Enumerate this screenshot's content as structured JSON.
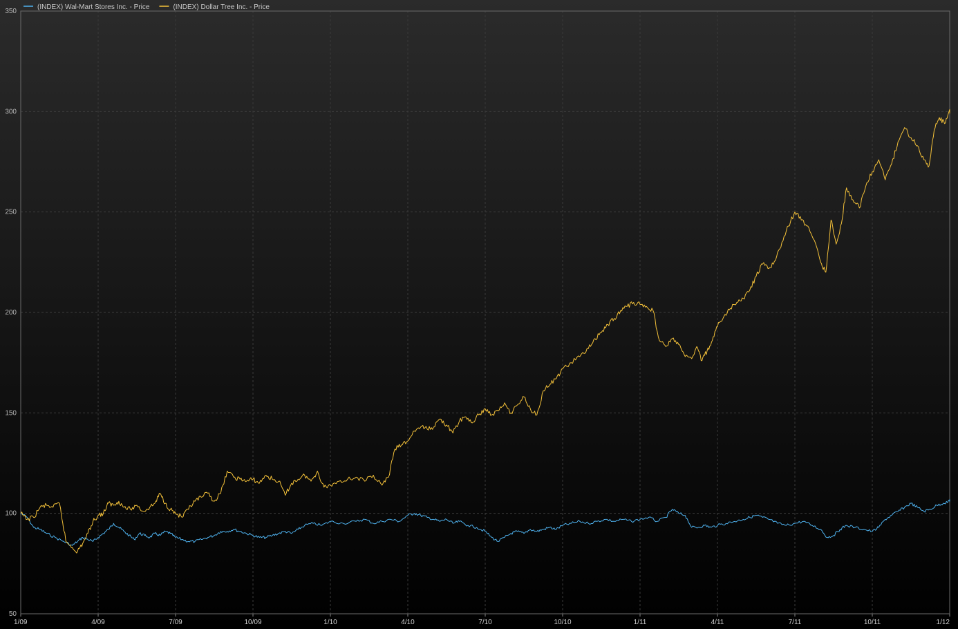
{
  "chart_data": {
    "type": "line",
    "title": "",
    "xlabel": "",
    "ylabel": "",
    "ylim": [
      50,
      350
    ],
    "y_ticks": [
      50,
      100,
      150,
      200,
      250,
      300,
      350
    ],
    "x_ticks": [
      "1/09",
      "4/09",
      "7/09",
      "10/09",
      "1/10",
      "4/10",
      "7/10",
      "10/10",
      "1/11",
      "4/11",
      "7/11",
      "10/11",
      "1/12"
    ],
    "grid": true,
    "legend_position": "top-left",
    "background_gradient": [
      "#2b2b2b",
      "#000000"
    ],
    "series": [
      {
        "name": "(INDEX) Wal-Mart Stores Inc. - Price",
        "color": "#4fb3f0",
        "points": [
          [
            "1/09",
            100
          ],
          [
            "1/09",
            98
          ],
          [
            "1/09",
            93
          ],
          [
            "1/09",
            92
          ],
          [
            "2/09",
            90
          ],
          [
            "2/09",
            88
          ],
          [
            "2/09",
            86
          ],
          [
            "3/09",
            84
          ],
          [
            "3/09",
            86
          ],
          [
            "3/09",
            88
          ],
          [
            "3/09",
            87
          ],
          [
            "3/09",
            86
          ],
          [
            "4/09",
            88
          ],
          [
            "4/09",
            90
          ],
          [
            "4/09",
            92
          ],
          [
            "4/09",
            95
          ],
          [
            "4/09",
            93
          ],
          [
            "5/09",
            91
          ],
          [
            "5/09",
            89
          ],
          [
            "5/09",
            87
          ],
          [
            "5/09",
            90
          ],
          [
            "5/09",
            89
          ],
          [
            "6/09",
            88
          ],
          [
            "6/09",
            90
          ],
          [
            "6/09",
            89
          ],
          [
            "6/09",
            91
          ],
          [
            "6/09",
            90
          ],
          [
            "7/09",
            88
          ],
          [
            "7/09",
            87
          ],
          [
            "7/09",
            86
          ],
          [
            "7/09",
            86
          ],
          [
            "8/09",
            87
          ],
          [
            "8/09",
            88
          ],
          [
            "8/09",
            89
          ],
          [
            "8/09",
            91
          ],
          [
            "9/09",
            91
          ],
          [
            "9/09",
            92
          ],
          [
            "9/09",
            91
          ],
          [
            "9/09",
            90
          ],
          [
            "10/09",
            89
          ],
          [
            "10/09",
            88
          ],
          [
            "10/09",
            88
          ],
          [
            "10/09",
            89
          ],
          [
            "11/09",
            90
          ],
          [
            "11/09",
            91
          ],
          [
            "11/09",
            90
          ],
          [
            "11/09",
            92
          ],
          [
            "12/09",
            94
          ],
          [
            "12/09",
            95
          ],
          [
            "12/09",
            94
          ],
          [
            "1/10",
            96
          ],
          [
            "1/10",
            95
          ],
          [
            "2/10",
            96
          ],
          [
            "2/10",
            97
          ],
          [
            "2/10",
            95
          ],
          [
            "3/10",
            96
          ],
          [
            "3/10",
            97
          ],
          [
            "3/10",
            96
          ],
          [
            "4/10",
            99
          ],
          [
            "4/10",
            100
          ],
          [
            "4/10",
            99
          ],
          [
            "4/10",
            98
          ],
          [
            "5/10",
            97
          ],
          [
            "5/10",
            96
          ],
          [
            "5/10",
            97
          ],
          [
            "5/10",
            95
          ],
          [
            "6/10",
            96
          ],
          [
            "6/10",
            94
          ],
          [
            "6/10",
            93
          ],
          [
            "7/10",
            91
          ],
          [
            "7/10",
            88
          ],
          [
            "7/10",
            86
          ],
          [
            "7/10",
            88
          ],
          [
            "8/10",
            90
          ],
          [
            "8/10",
            91
          ],
          [
            "8/10",
            90
          ],
          [
            "8/10",
            92
          ],
          [
            "9/10",
            91
          ],
          [
            "9/10",
            92
          ],
          [
            "9/10",
            93
          ],
          [
            "9/10",
            92
          ],
          [
            "10/10",
            94
          ],
          [
            "10/10",
            95
          ],
          [
            "10/10",
            96
          ],
          [
            "11/10",
            95
          ],
          [
            "11/10",
            96
          ],
          [
            "11/10",
            97
          ],
          [
            "12/10",
            96
          ],
          [
            "12/10",
            97
          ],
          [
            "12/10",
            96
          ],
          [
            "1/11",
            97
          ],
          [
            "1/11",
            98
          ],
          [
            "1/11",
            96
          ],
          [
            "2/11",
            98
          ],
          [
            "2/11",
            102
          ],
          [
            "2/11",
            100
          ],
          [
            "2/11",
            99
          ],
          [
            "3/11",
            93
          ],
          [
            "3/11",
            93
          ],
          [
            "3/11",
            94
          ],
          [
            "3/11",
            93
          ],
          [
            "4/11",
            94
          ],
          [
            "4/11",
            95
          ],
          [
            "4/11",
            96
          ],
          [
            "5/11",
            97
          ],
          [
            "5/11",
            98
          ],
          [
            "5/11",
            99
          ],
          [
            "5/11",
            98
          ],
          [
            "6/11",
            97
          ],
          [
            "6/11",
            95
          ],
          [
            "6/11",
            94
          ],
          [
            "7/11",
            95
          ],
          [
            "7/11",
            96
          ],
          [
            "7/11",
            94
          ],
          [
            "8/11",
            92
          ],
          [
            "8/11",
            88
          ],
          [
            "8/11",
            89
          ],
          [
            "8/11",
            92
          ],
          [
            "9/11",
            94
          ],
          [
            "9/11",
            93
          ],
          [
            "9/11",
            92
          ],
          [
            "10/11",
            91
          ],
          [
            "10/11",
            93
          ],
          [
            "10/11",
            97
          ],
          [
            "10/11",
            99
          ],
          [
            "11/11",
            101
          ],
          [
            "11/11",
            103
          ],
          [
            "11/11",
            105
          ],
          [
            "11/11",
            103
          ],
          [
            "12/11",
            101
          ],
          [
            "12/11",
            102
          ],
          [
            "12/11",
            104
          ],
          [
            "12/11",
            105
          ],
          [
            "1/12",
            106
          ],
          [
            "1/12",
            107
          ]
        ]
      },
      {
        "name": "(INDEX) Dollar Tree Inc. - Price",
        "color": "#f5c23a",
        "points": [
          [
            "1/09",
            100
          ],
          [
            "1/09",
            97
          ],
          [
            "1/09",
            98
          ],
          [
            "1/09",
            103
          ],
          [
            "2/09",
            104
          ],
          [
            "2/09",
            103
          ],
          [
            "2/09",
            105
          ],
          [
            "2/09",
            86
          ],
          [
            "3/09",
            83
          ],
          [
            "3/09",
            81
          ],
          [
            "3/09",
            85
          ],
          [
            "3/09",
            90
          ],
          [
            "3/09",
            96
          ],
          [
            "4/09",
            99
          ],
          [
            "4/09",
            100
          ],
          [
            "4/09",
            105
          ],
          [
            "4/09",
            104
          ],
          [
            "4/09",
            106
          ],
          [
            "5/09",
            103
          ],
          [
            "5/09",
            102
          ],
          [
            "5/09",
            104
          ],
          [
            "5/09",
            101
          ],
          [
            "6/09",
            103
          ],
          [
            "6/09",
            105
          ],
          [
            "6/09",
            110
          ],
          [
            "6/09",
            105
          ],
          [
            "6/09",
            102
          ],
          [
            "7/09",
            100
          ],
          [
            "7/09",
            98
          ],
          [
            "7/09",
            102
          ],
          [
            "7/09",
            106
          ],
          [
            "8/09",
            108
          ],
          [
            "8/09",
            110
          ],
          [
            "8/09",
            106
          ],
          [
            "8/09",
            110
          ],
          [
            "9/09",
            121
          ],
          [
            "9/09",
            118
          ],
          [
            "9/09",
            117
          ],
          [
            "9/09",
            116
          ],
          [
            "10/09",
            117
          ],
          [
            "10/09",
            115
          ],
          [
            "10/09",
            119
          ],
          [
            "10/09",
            117
          ],
          [
            "11/09",
            116
          ],
          [
            "11/09",
            109
          ],
          [
            "11/09",
            115
          ],
          [
            "11/09",
            117
          ],
          [
            "12/09",
            119
          ],
          [
            "12/09",
            116
          ],
          [
            "12/09",
            121
          ],
          [
            "12/09",
            113
          ],
          [
            "1/10",
            114
          ],
          [
            "1/10",
            116
          ],
          [
            "1/10",
            117
          ],
          [
            "2/10",
            118
          ],
          [
            "2/10",
            116
          ],
          [
            "2/10",
            119
          ],
          [
            "3/10",
            114
          ],
          [
            "3/10",
            118
          ],
          [
            "3/10",
            132
          ],
          [
            "3/10",
            134
          ],
          [
            "4/10",
            136
          ],
          [
            "4/10",
            141
          ],
          [
            "4/10",
            143
          ],
          [
            "4/10",
            142
          ],
          [
            "5/10",
            143
          ],
          [
            "5/10",
            147
          ],
          [
            "5/10",
            144
          ],
          [
            "5/10",
            140
          ],
          [
            "6/10",
            146
          ],
          [
            "6/10",
            148
          ],
          [
            "6/10",
            145
          ],
          [
            "6/10",
            149
          ],
          [
            "7/10",
            152
          ],
          [
            "7/10",
            149
          ],
          [
            "7/10",
            151
          ],
          [
            "7/10",
            155
          ],
          [
            "8/10",
            150
          ],
          [
            "8/10",
            154
          ],
          [
            "8/10",
            158
          ],
          [
            "8/10",
            152
          ],
          [
            "9/10",
            149
          ],
          [
            "9/10",
            161
          ],
          [
            "9/10",
            164
          ],
          [
            "9/10",
            167
          ],
          [
            "10/10",
            172
          ],
          [
            "10/10",
            175
          ],
          [
            "10/10",
            178
          ],
          [
            "11/10",
            182
          ],
          [
            "11/10",
            187
          ],
          [
            "11/10",
            190
          ],
          [
            "11/10",
            194
          ],
          [
            "12/10",
            197
          ],
          [
            "12/10",
            201
          ],
          [
            "12/10",
            203
          ],
          [
            "12/10",
            205
          ],
          [
            "1/11",
            204
          ],
          [
            "1/11",
            203
          ],
          [
            "1/11",
            201
          ],
          [
            "1/11",
            186
          ],
          [
            "2/11",
            183
          ],
          [
            "2/11",
            187
          ],
          [
            "2/11",
            184
          ],
          [
            "2/11",
            178
          ],
          [
            "3/11",
            177
          ],
          [
            "3/11",
            183
          ],
          [
            "3/11",
            176
          ],
          [
            "3/11",
            181
          ],
          [
            "3/11",
            186
          ],
          [
            "4/11",
            193
          ],
          [
            "4/11",
            198
          ],
          [
            "4/11",
            202
          ],
          [
            "4/11",
            205
          ],
          [
            "5/11",
            207
          ],
          [
            "5/11",
            211
          ],
          [
            "5/11",
            218
          ],
          [
            "5/11",
            224
          ],
          [
            "6/11",
            222
          ],
          [
            "6/11",
            226
          ],
          [
            "6/11",
            235
          ],
          [
            "6/11",
            243
          ],
          [
            "7/11",
            250
          ],
          [
            "7/11",
            246
          ],
          [
            "7/11",
            243
          ],
          [
            "7/11",
            236
          ],
          [
            "8/11",
            225
          ],
          [
            "8/11",
            220
          ],
          [
            "8/11",
            246
          ],
          [
            "8/11",
            234
          ],
          [
            "8/11",
            244
          ],
          [
            "9/11",
            262
          ],
          [
            "9/11",
            256
          ],
          [
            "9/11",
            252
          ],
          [
            "9/11",
            263
          ],
          [
            "10/11",
            270
          ],
          [
            "10/11",
            276
          ],
          [
            "10/11",
            266
          ],
          [
            "10/11",
            274
          ],
          [
            "11/11",
            285
          ],
          [
            "11/11",
            292
          ],
          [
            "11/11",
            287
          ],
          [
            "11/11",
            283
          ],
          [
            "12/11",
            276
          ],
          [
            "12/11",
            273
          ],
          [
            "12/11",
            291
          ],
          [
            "12/11",
            297
          ],
          [
            "12/11",
            294
          ],
          [
            "1/12",
            301
          ],
          [
            "1/12",
            299
          ]
        ]
      }
    ]
  }
}
